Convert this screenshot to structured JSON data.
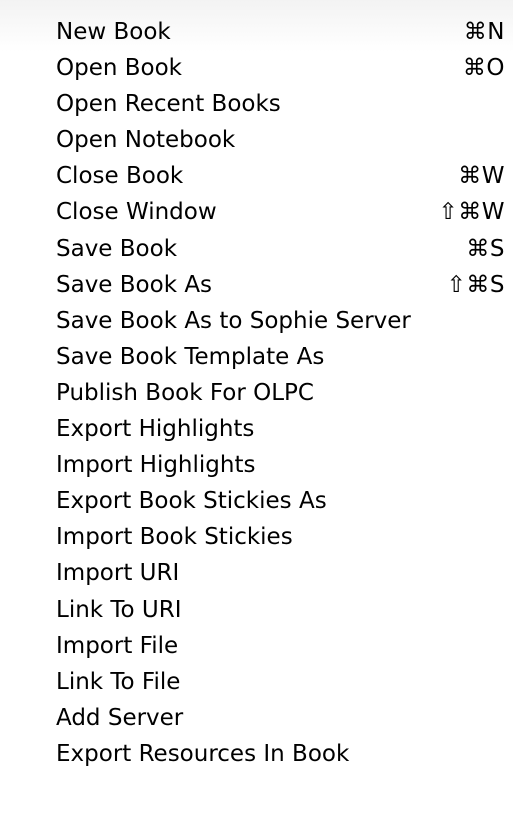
{
  "menu": {
    "items": [
      {
        "label": "New Book",
        "shortcut": "⌘N"
      },
      {
        "label": "Open Book",
        "shortcut": "⌘O"
      },
      {
        "label": "Open Recent Books",
        "shortcut": ""
      },
      {
        "label": "Open Notebook",
        "shortcut": ""
      },
      {
        "label": "Close Book",
        "shortcut": "⌘W"
      },
      {
        "label": "Close Window",
        "shortcut": "⇧⌘W"
      },
      {
        "label": "Save Book",
        "shortcut": "⌘S"
      },
      {
        "label": "Save Book As",
        "shortcut": "⇧⌘S"
      },
      {
        "label": "Save Book As to Sophie Server",
        "shortcut": ""
      },
      {
        "label": "Save Book Template As",
        "shortcut": ""
      },
      {
        "label": "Publish Book For OLPC",
        "shortcut": ""
      },
      {
        "label": "Export Highlights",
        "shortcut": ""
      },
      {
        "label": "Import Highlights",
        "shortcut": ""
      },
      {
        "label": "Export Book Stickies As",
        "shortcut": ""
      },
      {
        "label": "Import Book Stickies",
        "shortcut": ""
      },
      {
        "label": "Import URI",
        "shortcut": ""
      },
      {
        "label": "Link To URI",
        "shortcut": ""
      },
      {
        "label": "Import File",
        "shortcut": ""
      },
      {
        "label": "Link To File",
        "shortcut": ""
      },
      {
        "label": "Add Server",
        "shortcut": ""
      },
      {
        "label": "Export Resources In Book",
        "shortcut": ""
      }
    ]
  }
}
